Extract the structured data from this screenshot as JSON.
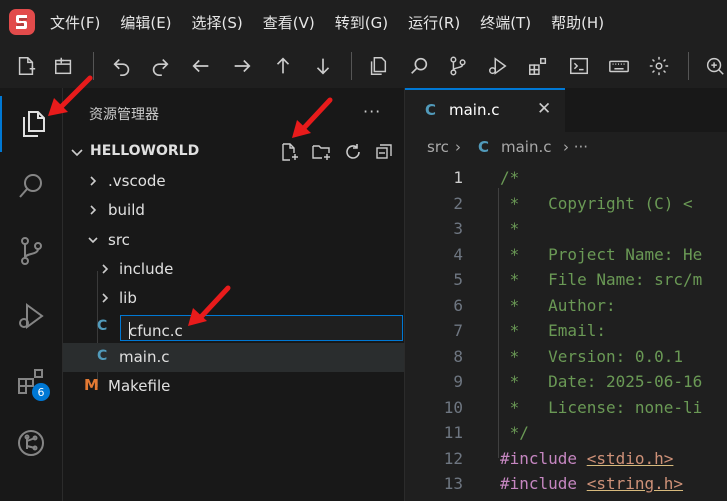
{
  "menu": [
    "文件(F)",
    "编辑(E)",
    "选择(S)",
    "查看(V)",
    "转到(G)",
    "运行(R)",
    "终端(T)",
    "帮助(H)"
  ],
  "activity": {
    "extensions_badge": "6"
  },
  "sidebar": {
    "title": "资源管理器",
    "more": "···",
    "folder": "HELLOWORLD",
    "tree": [
      {
        "label": ".vscode",
        "kind": "folder",
        "chevron": "›"
      },
      {
        "label": "build",
        "kind": "folder",
        "chevron": "›"
      },
      {
        "label": "src",
        "kind": "folder",
        "chevron": "⌄"
      },
      {
        "label": "include",
        "kind": "folder",
        "chevron": "›"
      },
      {
        "label": "lib",
        "kind": "folder",
        "chevron": "›"
      },
      {
        "label": "main.c",
        "kind": "c-file",
        "icon": "C"
      },
      {
        "label": "Makefile",
        "kind": "makefile",
        "icon": "M"
      }
    ],
    "rename_value": "cfunc.c",
    "rename_icon": "C"
  },
  "editor": {
    "tab": {
      "icon": "C",
      "label": "main.c",
      "close": "✕"
    },
    "breadcrumb": {
      "folder": "src",
      "sep": "›",
      "icon": "C",
      "file": "main.c",
      "more": "›  ···"
    },
    "lines": [
      {
        "n": "1",
        "text": "/*"
      },
      {
        "n": "2",
        "text": " *   Copyright (C) <"
      },
      {
        "n": "3",
        "text": " *"
      },
      {
        "n": "4",
        "text": " *   Project Name: He"
      },
      {
        "n": "5",
        "text": " *   File Name: src/m"
      },
      {
        "n": "6",
        "text": " *   Author:"
      },
      {
        "n": "7",
        "text": " *   Email:"
      },
      {
        "n": "8",
        "text": " *   Version: 0.0.1"
      },
      {
        "n": "9",
        "text": " *   Date: 2025-06-16"
      },
      {
        "n": "10",
        "text": " *   License: none-li"
      },
      {
        "n": "11",
        "text": " */"
      },
      {
        "n": "12",
        "kw": "#include",
        "inc": "<stdio.h>"
      },
      {
        "n": "13",
        "kw": "#include",
        "inc": "<string.h>"
      }
    ]
  },
  "colors": {
    "accent": "#0078d4",
    "annotation_arrow": "#e81b1b",
    "c_icon": "#519aba",
    "makefile_icon": "#e37933"
  }
}
